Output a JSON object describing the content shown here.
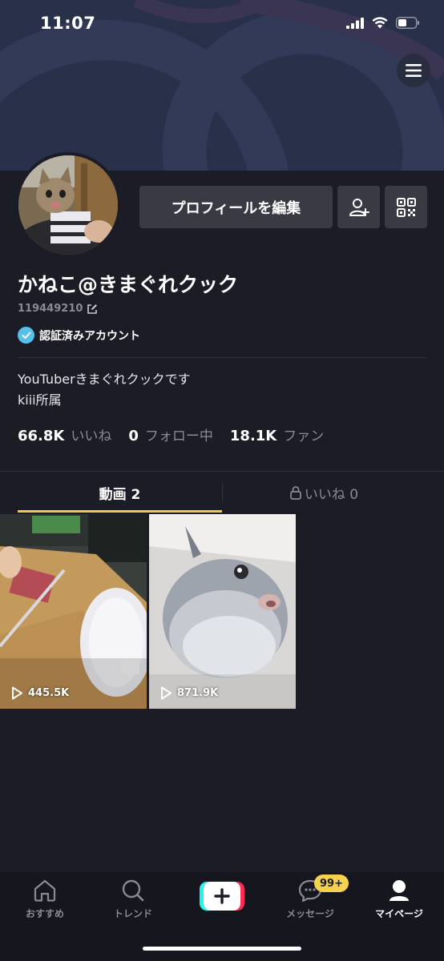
{
  "status_bar": {
    "time": "11:07"
  },
  "profile": {
    "display_name": "かねこ@きまぐれクック",
    "user_id": "119449210",
    "verified_label": "認証済みアカウント",
    "edit_profile_label": "プロフィールを編集",
    "bio_line1": "YouTuberきまぐれクックです",
    "bio_line2": "kiii所属"
  },
  "stats": {
    "likes_count": "66.8K",
    "likes_label": "いいね",
    "following_count": "0",
    "following_label": "フォロー中",
    "fans_count": "18.1K",
    "fans_label": "ファン"
  },
  "tabs": {
    "videos_label": "動画 2",
    "liked_label": "いいね 0"
  },
  "videos": [
    {
      "views": "445.5K"
    },
    {
      "views": "871.9K"
    }
  ],
  "bottom_nav": {
    "home": "おすすめ",
    "trend": "トレンド",
    "messages": "メッセージ",
    "messages_badge": "99+",
    "me": "マイページ"
  },
  "colors": {
    "background": "#1c1c27",
    "accent_tab": "#f2c94c",
    "verified": "#57c0e8",
    "badge": "#f5d24d"
  },
  "icons": [
    "menu-icon",
    "add-friend-icon",
    "qr-code-icon",
    "edit-pencil-icon",
    "verified-check-icon",
    "lock-icon",
    "play-icon",
    "home-icon",
    "search-icon",
    "plus-icon",
    "message-icon",
    "person-icon"
  ]
}
